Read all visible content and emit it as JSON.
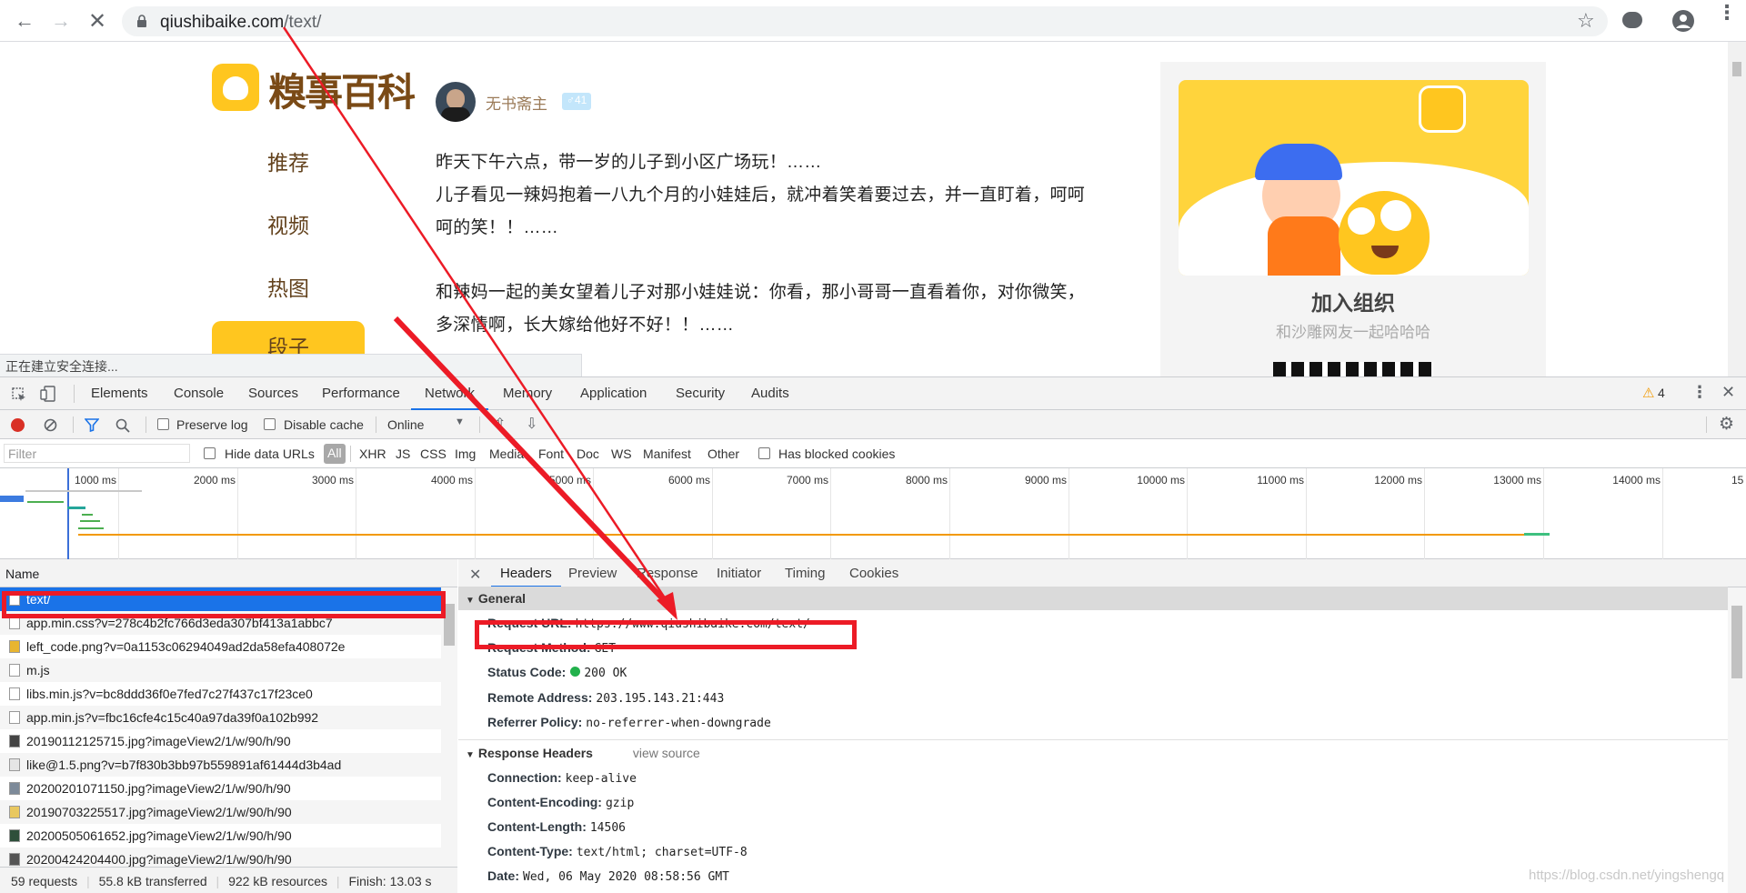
{
  "browser": {
    "url_host": "qiushibaike.com",
    "url_path": "/text/"
  },
  "site": {
    "logo_text": "糗事百科",
    "nav": [
      "推荐",
      "视频",
      "热图",
      "段子"
    ],
    "author": {
      "name": "无书斋主",
      "badge": "♂41"
    },
    "post_lines": [
      "昨天下午六点，带一岁的儿子到小区广场玩！……",
      "儿子看见一辣妈抱着一八九个月的小娃娃后，就冲着笑着要过去，并一直盯着，呵呵",
      "呵的笑！！……",
      "和辣妈一起的美女望着儿子对那小娃娃说：你看，那小哥哥一直看着你，对你微笑，",
      "多深情啊，长大嫁给他好不好！！……"
    ],
    "promo": {
      "title": "加入组织",
      "subtitle": "和沙雕网友一起哈哈哈"
    },
    "status_bubble": "正在建立安全连接..."
  },
  "devtools": {
    "tabs": [
      "Elements",
      "Console",
      "Sources",
      "Performance",
      "Network",
      "Memory",
      "Application",
      "Security",
      "Audits"
    ],
    "warning_count": "4",
    "controls": {
      "preserve_log": "Preserve log",
      "disable_cache": "Disable cache",
      "throttle": "Online"
    },
    "filter": {
      "placeholder": "Filter",
      "hide_data_urls": "Hide data URLs",
      "types": [
        "All",
        "XHR",
        "JS",
        "CSS",
        "Img",
        "Media",
        "Font",
        "Doc",
        "WS",
        "Manifest",
        "Other"
      ],
      "has_blocked": "Has blocked cookies"
    },
    "timeline_ticks": [
      "1000 ms",
      "2000 ms",
      "3000 ms",
      "4000 ms",
      "5000 ms",
      "6000 ms",
      "7000 ms",
      "8000 ms",
      "9000 ms",
      "10000 ms",
      "11000 ms",
      "12000 ms",
      "13000 ms",
      "14000 ms",
      "15"
    ],
    "list_header": "Name",
    "requests": [
      "text/",
      "app.min.css?v=278c4b2fc766d3eda307bf413a1abbc7",
      "left_code.png?v=0a1153c06294049ad2da58efa408072e",
      "m.js",
      "libs.min.js?v=bc8ddd36f0e7fed7c27f437c17f23ce0",
      "app.min.js?v=fbc16cfe4c15c40a97da39f0a102b992",
      "20190112125715.jpg?imageView2/1/w/90/h/90",
      "like@1.5.png?v=b7f830b3bb97b559891af61444d3b4ad",
      "20200201071150.jpg?imageView2/1/w/90/h/90",
      "20190703225517.jpg?imageView2/1/w/90/h/90",
      "20200505061652.jpg?imageView2/1/w/90/h/90",
      "20200424204400.jpg?imageView2/1/w/90/h/90"
    ],
    "summary": [
      "59 requests",
      "55.8 kB transferred",
      "922 kB resources",
      "Finish: 13.03 s"
    ],
    "detail_tabs": [
      "Headers",
      "Preview",
      "Response",
      "Initiator",
      "Timing",
      "Cookies"
    ],
    "general": {
      "title": "General",
      "rows": [
        {
          "k": "Request URL:",
          "v": "https://www.qiushibaike.com/text/"
        },
        {
          "k": "Request Method:",
          "v": "GET"
        },
        {
          "k": "Status Code:",
          "v": "200 OK"
        },
        {
          "k": "Remote Address:",
          "v": "203.195.143.21:443"
        },
        {
          "k": "Referrer Policy:",
          "v": "no-referrer-when-downgrade"
        }
      ]
    },
    "response_headers": {
      "title": "Response Headers",
      "view_source": "view source",
      "rows": [
        {
          "k": "Connection:",
          "v": "keep-alive"
        },
        {
          "k": "Content-Encoding:",
          "v": "gzip"
        },
        {
          "k": "Content-Length:",
          "v": "14506"
        },
        {
          "k": "Content-Type:",
          "v": "text/html; charset=UTF-8"
        },
        {
          "k": "Date:",
          "v": "Wed, 06 May 2020 08:58:56 GMT"
        }
      ]
    }
  },
  "watermark": "https://blog.csdn.net/yingshengq",
  "colors": {
    "accent": "#1a73e8",
    "annotation": "#ec1b26",
    "brand_yellow": "#ffc61f"
  }
}
